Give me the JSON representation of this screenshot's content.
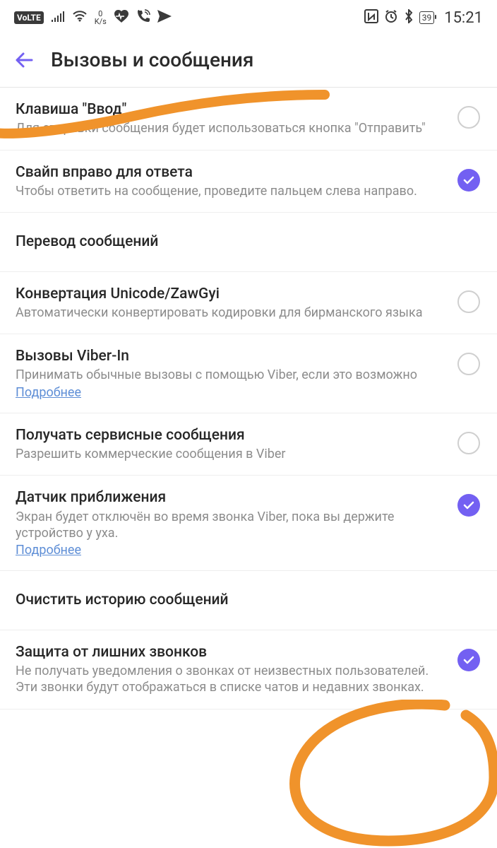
{
  "status": {
    "volte": "VoLTE",
    "kbs_value": "0",
    "kbs_label": "K/s",
    "battery": "39",
    "time": "15:21"
  },
  "header": {
    "title": "Вызовы и сообщения"
  },
  "items": [
    {
      "type": "toggle",
      "title": "Клавиша \"Ввод\"",
      "sub": "Для отправки сообщения будет использоваться кнопка \"Отправить\"",
      "checked": false
    },
    {
      "type": "toggle",
      "title": "Свайп вправо для ответа",
      "sub": "Чтобы ответить на сообщение, проведите пальцем слева направо.",
      "checked": true
    },
    {
      "type": "section",
      "title": "Перевод сообщений"
    },
    {
      "type": "toggle",
      "title": "Конвертация Unicode/ZawGyi",
      "sub": "Автоматически конвертировать кодировки для бирманского языка",
      "checked": false
    },
    {
      "type": "toggle",
      "title": "Вызовы Viber-In",
      "sub": "Принимать обычные вызовы с помощью Viber, если это возможно",
      "link": "Подробнее",
      "checked": false
    },
    {
      "type": "toggle",
      "title": "Получать сервисные сообщения",
      "sub": "Разрешить коммерческие сообщения в Viber",
      "checked": false
    },
    {
      "type": "toggle",
      "title": "Датчик приближения",
      "sub": "Экран будет отключён во время звонка Viber, пока вы держите устройство у уха.",
      "link": "Подробнее",
      "checked": true
    },
    {
      "type": "section",
      "title": "Очистить историю сообщений"
    },
    {
      "type": "toggle",
      "title": "Защита от лишних звонков",
      "sub": "Не получать уведомления о звонках от неизвестных пользователей. Эти звонки будут отображаться в списке чатов и недавних звонках.",
      "checked": true
    }
  ]
}
